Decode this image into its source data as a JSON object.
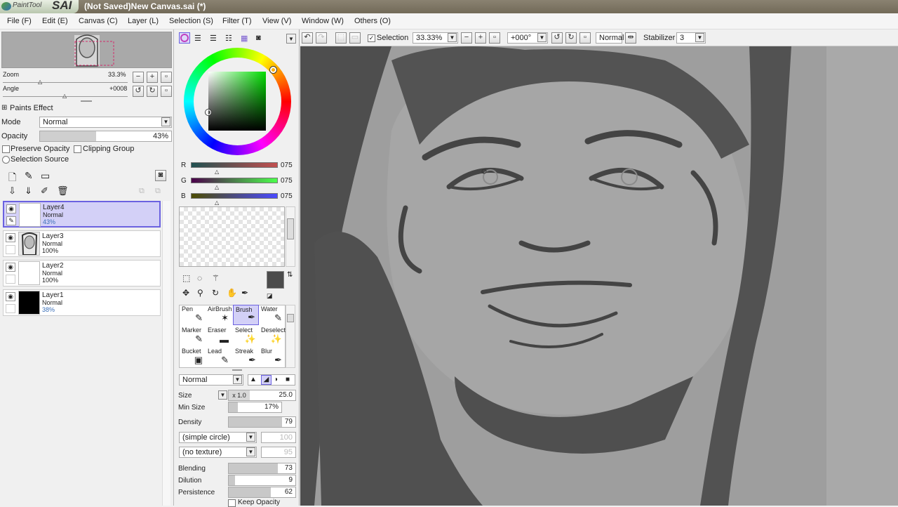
{
  "app": {
    "logo_text": "PaintTool",
    "logo_sai": "SAI",
    "title": "(Not Saved)New Canvas.sai (*)"
  },
  "menu": [
    "File (F)",
    "Edit (E)",
    "Canvas (C)",
    "Layer (L)",
    "Selection (S)",
    "Filter (T)",
    "View (V)",
    "Window (W)",
    "Others (O)"
  ],
  "navigator": {
    "zoom_label": "Zoom",
    "zoom_value": "33.3%",
    "angle_label": "Angle",
    "angle_value": "+0008"
  },
  "paints_effect": {
    "label": "Paints Effect",
    "mode_label": "Mode",
    "mode_value": "Normal",
    "opacity_label": "Opacity",
    "opacity_value": "43%",
    "opacity_fraction": 0.43
  },
  "layer_opts": {
    "preserve_opacity": "Preserve Opacity",
    "clipping_group": "Clipping Group",
    "selection_source": "Selection Source"
  },
  "layers": [
    {
      "name": "Layer4",
      "mode": "Normal",
      "opacity": "43%"
    },
    {
      "name": "Layer3",
      "mode": "Normal",
      "opacity": "100%"
    },
    {
      "name": "Layer2",
      "mode": "Normal",
      "opacity": "100%"
    },
    {
      "name": "Layer1",
      "mode": "Normal",
      "opacity": "38%"
    }
  ],
  "color": {
    "r_label": "R",
    "g_label": "G",
    "b_label": "B",
    "r": "075",
    "g": "075",
    "b": "075",
    "primary": "#4b4b4b"
  },
  "tools": [
    {
      "label": "Pen",
      "icon": "✎"
    },
    {
      "label": "AirBrush",
      "icon": "✶"
    },
    {
      "label": "Brush",
      "icon": "✒"
    },
    {
      "label": "Water",
      "icon": "✎"
    },
    {
      "label": "Marker",
      "icon": "✎"
    },
    {
      "label": "Eraser",
      "icon": "▬"
    },
    {
      "label": "Select",
      "icon": "✨"
    },
    {
      "label": "Deselect",
      "icon": "✨"
    },
    {
      "label": "Bucket",
      "icon": "▣"
    },
    {
      "label": "Lead",
      "icon": "✎"
    },
    {
      "label": "Streak",
      "icon": "✒"
    },
    {
      "label": "Blur",
      "icon": "✒"
    }
  ],
  "brush": {
    "mode": "Normal",
    "size_label": "Size",
    "size_mult": "x 1.0",
    "size_value": "25.0",
    "minsize_label": "Min Size",
    "minsize_value": "17%",
    "density_label": "Density",
    "density_value": "79",
    "shape": "(simple circle)",
    "shape_value": "100",
    "texture": "(no texture)",
    "texture_value": "95",
    "blending_label": "Blending",
    "blending_value": "73",
    "dilution_label": "Dilution",
    "dilution_value": "9",
    "persistence_label": "Persistence",
    "persistence_value": "62",
    "keep_opacity": "Keep Opacity"
  },
  "toolbar": {
    "selection_label": "Selection",
    "zoom": "33.33%",
    "angle": "+000°",
    "mode": "Normal",
    "stabilizer_label": "Stabilizer",
    "stabilizer_value": "3"
  }
}
